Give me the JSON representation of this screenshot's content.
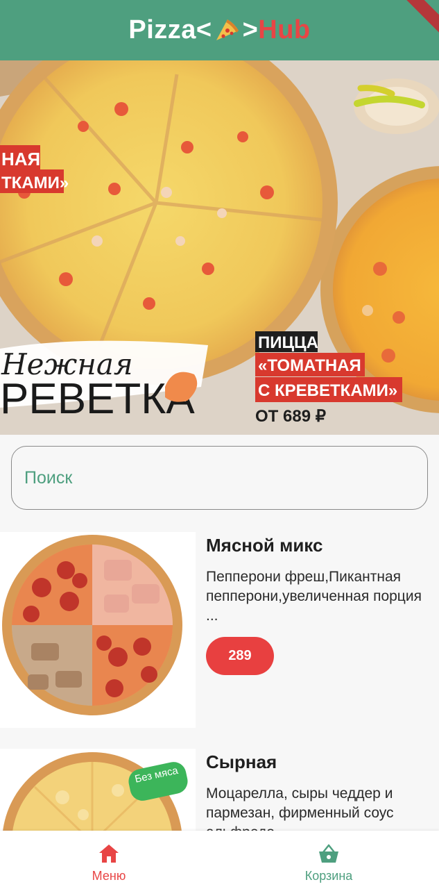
{
  "app_bar": {
    "title_pizza": "Pizza<",
    "title_mid": ">",
    "title_hub": "Hub",
    "bg_color": "#4e9f7f",
    "accent_color": "#e84545",
    "logo_icon": "pizza-slice-icon"
  },
  "banner": {
    "icon": "promo-banner-image",
    "promo_line1": "ПИЦЦА",
    "promo_line2": "«ТОМАТНАЯ",
    "promo_line3": "С КРЕВЕТКАМИ»",
    "promo_price": "ОТ 689 ₽",
    "script_text": "Нежная",
    "big_text": "РЕВЕТКА",
    "left_tag_1": "НАЯ",
    "left_tag_2": "ТКАМИ»"
  },
  "search": {
    "placeholder": "Поиск"
  },
  "products": [
    {
      "name": "Мясной микс",
      "description": "Пепперони фреш,Пикантная пепперони,увеличенная порция ...",
      "price": "289",
      "image": "meat-mix-pizza-image"
    },
    {
      "name": "Сырная",
      "description": "Моцарелла, сыры чеддер и пармезан, фирменный соус альфредо",
      "badge": "Без мяса",
      "image": "cheese-pizza-image"
    }
  ],
  "bottom_nav": {
    "menu_label": "Меню",
    "menu_icon": "home-icon",
    "cart_label": "Корзина",
    "cart_icon": "basket-icon",
    "active_color": "#e84545",
    "inactive_color": "#4e9f7f"
  }
}
